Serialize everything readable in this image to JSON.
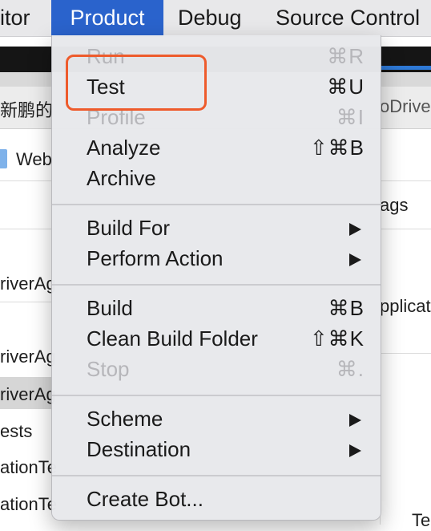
{
  "menubar": {
    "items": [
      "itor",
      "Product",
      "Debug",
      "Source Control"
    ]
  },
  "background": {
    "tab_text": "新鹏的",
    "tab_right": "oDriver",
    "file_label": "Web",
    "col_header": "ags",
    "row1": "riverAg",
    "row2": "riverAg",
    "row3": "riverAg",
    "row4": "ests",
    "row5": "ationTe",
    "row6": "ationTe",
    "right_text": "pplicat",
    "bottom_right": "Te"
  },
  "menu": {
    "run": {
      "label": "Run",
      "shortcut": "⌘R"
    },
    "test": {
      "label": "Test",
      "shortcut": "⌘U"
    },
    "profile": {
      "label": "Profile",
      "shortcut": "⌘I"
    },
    "analyze": {
      "label": "Analyze",
      "shortcut": "⇧⌘B"
    },
    "archive": {
      "label": "Archive"
    },
    "build_for": {
      "label": "Build For"
    },
    "perform_action": {
      "label": "Perform Action"
    },
    "build": {
      "label": "Build",
      "shortcut": "⌘B"
    },
    "clean_build_folder": {
      "label": "Clean Build Folder",
      "shortcut": "⇧⌘K"
    },
    "stop": {
      "label": "Stop",
      "shortcut": "⌘."
    },
    "scheme": {
      "label": "Scheme"
    },
    "destination": {
      "label": "Destination"
    },
    "create_bot": {
      "label": "Create Bot..."
    }
  },
  "colors": {
    "menubar_active": "#2a63cc",
    "highlight_annotation": "#ee5b2c"
  }
}
